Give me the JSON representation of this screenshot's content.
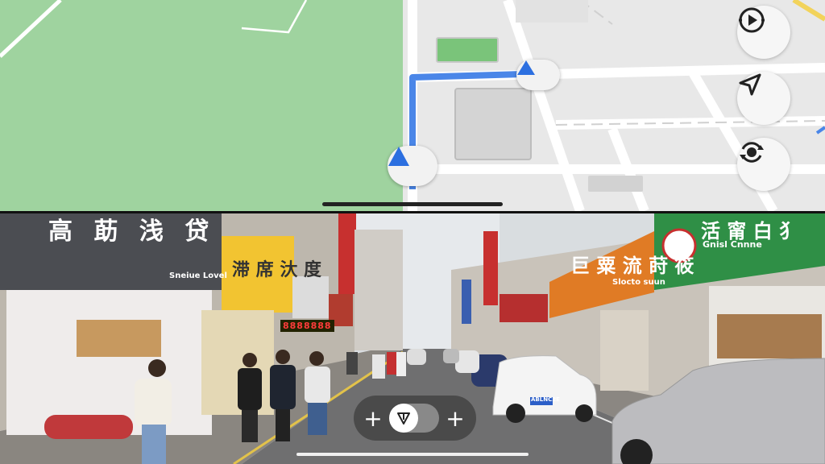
{
  "map": {
    "buttons": [
      {
        "name": "play-route",
        "icon": "play-circle-icon"
      },
      {
        "name": "locate-me",
        "icon": "navigation-arrow-icon"
      },
      {
        "name": "recenter",
        "icon": "recenter-icon"
      }
    ],
    "route_color": "#4a86e8",
    "park_color": "#9fd39f"
  },
  "street_view": {
    "signs": {
      "left": "高 莇 浅 贷",
      "left_sub": "Sneiue Lovel",
      "yellow": "滞 席 汏 度",
      "orange": "巨 粟 流 莳 筱",
      "orange_sub": "Slocto suun",
      "green": "活 甯 白 犭",
      "green_sub": "Gnisl Cnnne",
      "led": "8888888"
    },
    "plate": "ABLNC2E"
  },
  "controls": {
    "zoom_out": "+",
    "zoom_in": "+",
    "compass_icon": "compass-arrow-icon"
  }
}
